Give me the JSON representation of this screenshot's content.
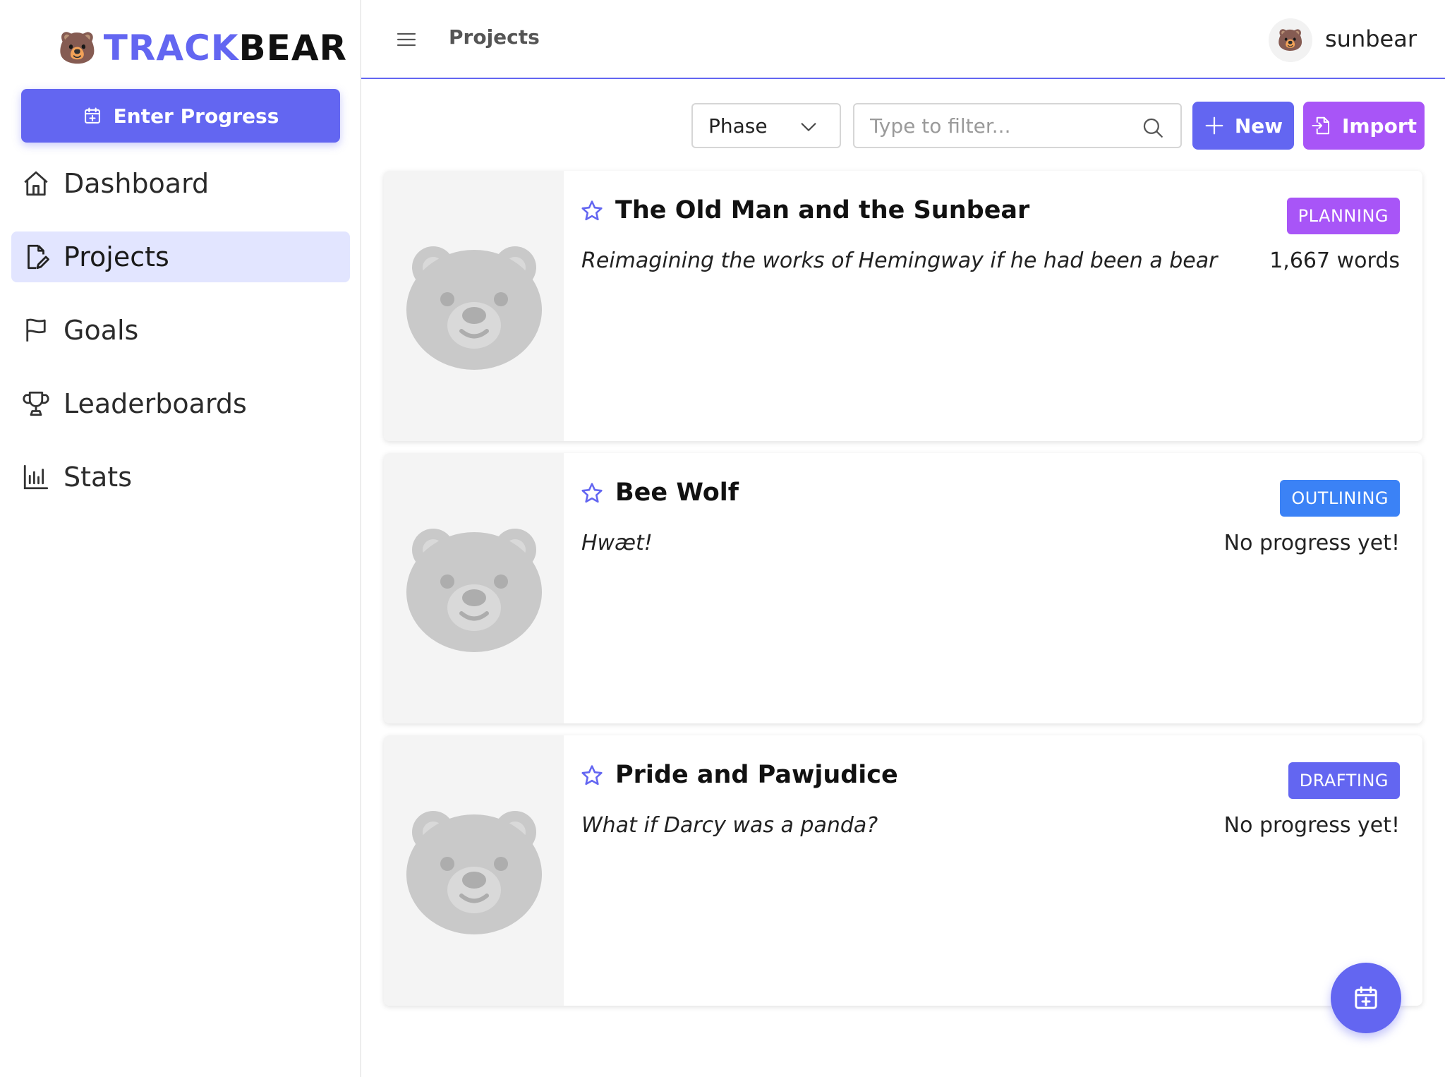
{
  "app": {
    "logo_emoji": "🐻",
    "logo_part1": "TRACK",
    "logo_part2": "BEAR"
  },
  "sidebar": {
    "enter_progress_label": "Enter Progress",
    "items": [
      {
        "label": "Dashboard",
        "icon": "home-icon",
        "active": false
      },
      {
        "label": "Projects",
        "icon": "edit-document-icon",
        "active": true
      },
      {
        "label": "Goals",
        "icon": "flag-icon",
        "active": false
      },
      {
        "label": "Leaderboards",
        "icon": "trophy-icon",
        "active": false
      },
      {
        "label": "Stats",
        "icon": "bar-chart-icon",
        "active": false
      }
    ]
  },
  "header": {
    "breadcrumb": "Projects",
    "avatar_emoji": "🐻",
    "username": "sunbear"
  },
  "toolbar": {
    "phase_label": "Phase",
    "filter_placeholder": "Type to filter...",
    "new_label": "New",
    "import_label": "Import"
  },
  "projects": [
    {
      "title": "The Old Man and the Sunbear",
      "description": "Reimagining the works of Hemingway if he had been a bear",
      "phase": "PLANNING",
      "phase_color": "#a855f7",
      "progress": "1,667 words"
    },
    {
      "title": "Bee Wolf",
      "description": "Hwæt!",
      "phase": "OUTLINING",
      "phase_color": "#3b82f6",
      "progress": "No progress yet!"
    },
    {
      "title": "Pride and Pawjudice",
      "description": "What if Darcy was a panda?",
      "phase": "DRAFTING",
      "phase_color": "#6366f1",
      "progress": "No progress yet!"
    }
  ],
  "colors": {
    "primary": "#6366f1",
    "import": "#a855f7",
    "active_nav": "#e2e5ff"
  }
}
